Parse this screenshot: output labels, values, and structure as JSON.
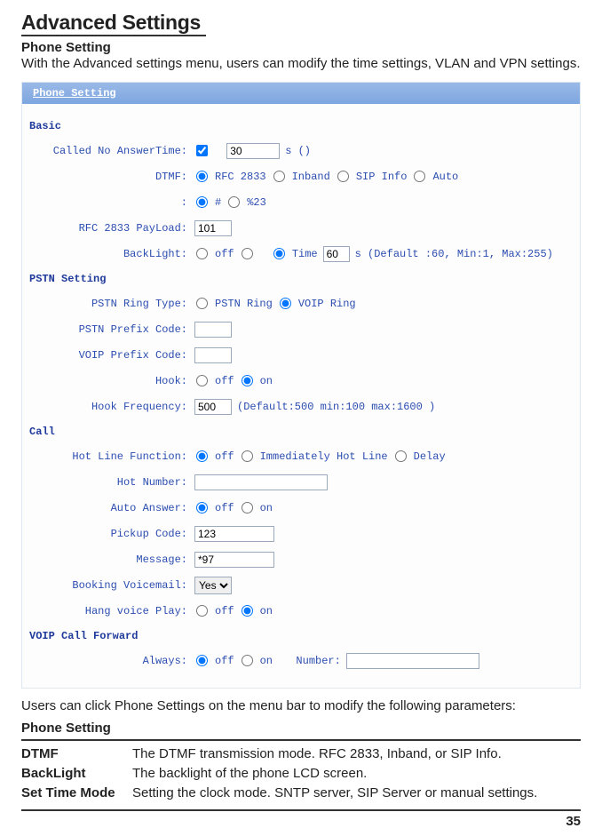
{
  "heading": {
    "title": "Advanced Settings",
    "subtitle": "Phone Setting",
    "intro": "With the Advanced settings menu, users can modify the time settings, VLAN and VPN settings."
  },
  "panel": {
    "header": "Phone Setting",
    "basic": {
      "section": "Basic",
      "noAnswerLabel": "Called No AnswerTime:",
      "noAnswerValue": "30",
      "noAnswerSuffix": "s   ()",
      "dtmfLabel": "DTMF:",
      "dtmfOptions": {
        "rfc": "RFC 2833",
        "inband": "Inband",
        "sip": "SIP Info",
        "auto": "Auto"
      },
      "hashLabel": ":",
      "hashOptions": {
        "hash": "#",
        "pct": "%23"
      },
      "payloadLabel": "RFC 2833 PayLoad:",
      "payloadValue": "101",
      "backlightLabel": "BackLight:",
      "backlightOptions": {
        "off": "off",
        "time": "Time"
      },
      "backlightValue": "60",
      "backlightSuffix": "s (Default :60, Min:1, Max:255)"
    },
    "pstn": {
      "section": "PSTN Setting",
      "ringTypeLabel": "PSTN Ring Type:",
      "ringOptions": {
        "pstn": "PSTN Ring",
        "voip": "VOIP Ring"
      },
      "pstnPrefixLabel": "PSTN Prefix Code:",
      "voipPrefixLabel": "VOIP Prefix Code:",
      "hookLabel": "Hook:",
      "hookOptions": {
        "off": "off",
        "on": "on"
      },
      "hookFreqLabel": "Hook Frequency:",
      "hookFreqValue": "500",
      "hookFreqSuffix": "(Default:500 min:100 max:1600 )"
    },
    "call": {
      "section": "Call",
      "hotLineFuncLabel": "Hot Line Function:",
      "hotLineOptions": {
        "off": "off",
        "imm": "Immediately Hot Line",
        "delay": "Delay"
      },
      "hotNumberLabel": "Hot Number:",
      "autoAnswerLabel": "Auto Answer:",
      "autoAnswerOptions": {
        "off": "off",
        "on": "on"
      },
      "pickupLabel": "Pickup Code:",
      "pickupValue": "123",
      "messageLabel": "Message:",
      "messageValue": "*97",
      "voicemailLabel": "Booking Voicemail:",
      "voicemailValue": "Yes",
      "hangLabel": "Hang voice Play:",
      "hangOptions": {
        "off": "off",
        "on": "on"
      }
    },
    "forward": {
      "section": "VOIP Call Forward",
      "alwaysLabel": "Always:",
      "alwaysOptions": {
        "off": "off",
        "on": "on"
      },
      "numberLabel": "Number:"
    }
  },
  "below": {
    "caption": "Users can click Phone Settings on the menu bar to modify the following parameters:",
    "subhead": "Phone Setting",
    "rows": [
      {
        "term": "DTMF",
        "desc": "The DTMF transmission mode.  RFC 2833, Inband, or SIP Info."
      },
      {
        "term": "BackLight",
        "desc": "The backlight of the phone LCD screen."
      },
      {
        "term": "Set Time Mode",
        "desc": "Setting the clock mode. SNTP server, SIP Server or manual settings."
      }
    ]
  },
  "footer": {
    "page": "35"
  }
}
